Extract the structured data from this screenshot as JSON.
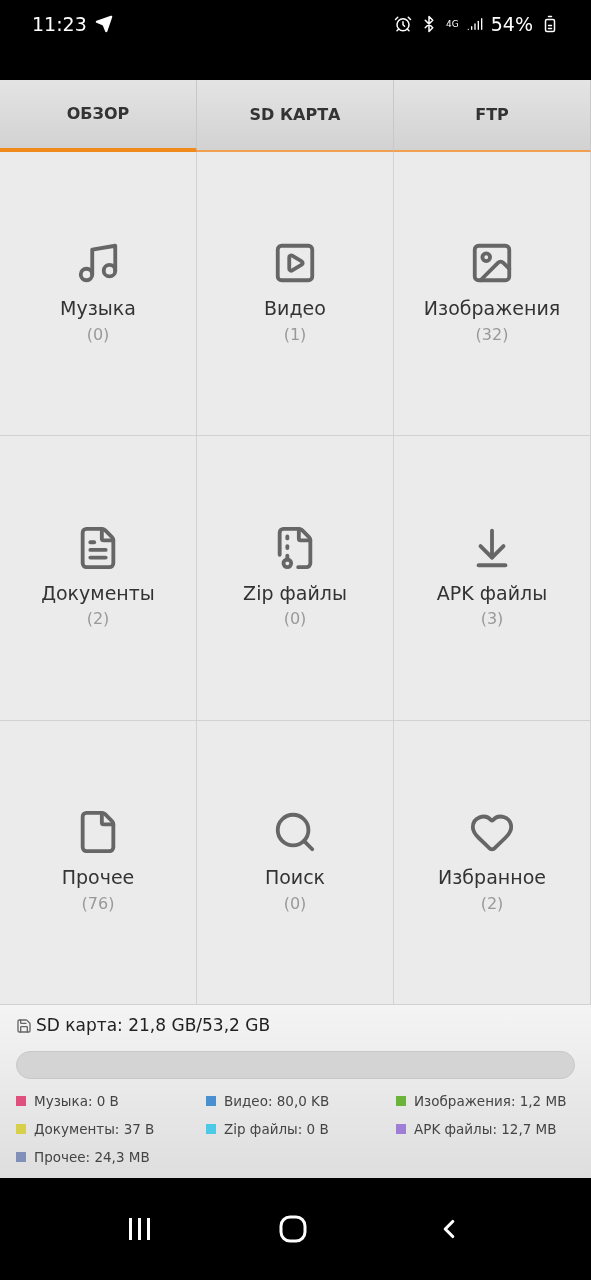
{
  "status_bar": {
    "time": "11:23",
    "network": "4G",
    "battery": "54%"
  },
  "tabs": [
    {
      "label": "ОБЗОР",
      "selected": true
    },
    {
      "label": "SD КАРТА",
      "selected": false
    },
    {
      "label": "FTP",
      "selected": false
    }
  ],
  "categories": [
    {
      "kind": "music",
      "label": "Музыка",
      "count": "(0)"
    },
    {
      "kind": "video",
      "label": "Видео",
      "count": "(1)"
    },
    {
      "kind": "image",
      "label": "Изображения",
      "count": "(32)"
    },
    {
      "kind": "document",
      "label": "Документы",
      "count": "(2)"
    },
    {
      "kind": "zip",
      "label": "Zip файлы",
      "count": "(0)"
    },
    {
      "kind": "apk",
      "label": "APK файлы",
      "count": "(3)"
    },
    {
      "kind": "other",
      "label": "Прочее",
      "count": "(76)"
    },
    {
      "kind": "search",
      "label": "Поиск",
      "count": "(0)"
    },
    {
      "kind": "favorite",
      "label": "Избранное",
      "count": "(2)"
    }
  ],
  "storage": {
    "title": "SD карта: 21,8 GB/53,2 GB",
    "legend": [
      {
        "label": "Музыка: 0 B",
        "color": "#e0507f"
      },
      {
        "label": "Видео: 80,0 KB",
        "color": "#4a8fd0"
      },
      {
        "label": "Изображения: 1,2 MB",
        "color": "#6cb33a"
      },
      {
        "label": "Документы: 37 B",
        "color": "#d8cf4a"
      },
      {
        "label": "Zip файлы: 0 B",
        "color": "#4cc9e6"
      },
      {
        "label": "APK файлы: 12,7 MB",
        "color": "#9f7fd6"
      },
      {
        "label": "Прочее: 24,3 MB",
        "color": "#8090b8"
      }
    ]
  }
}
